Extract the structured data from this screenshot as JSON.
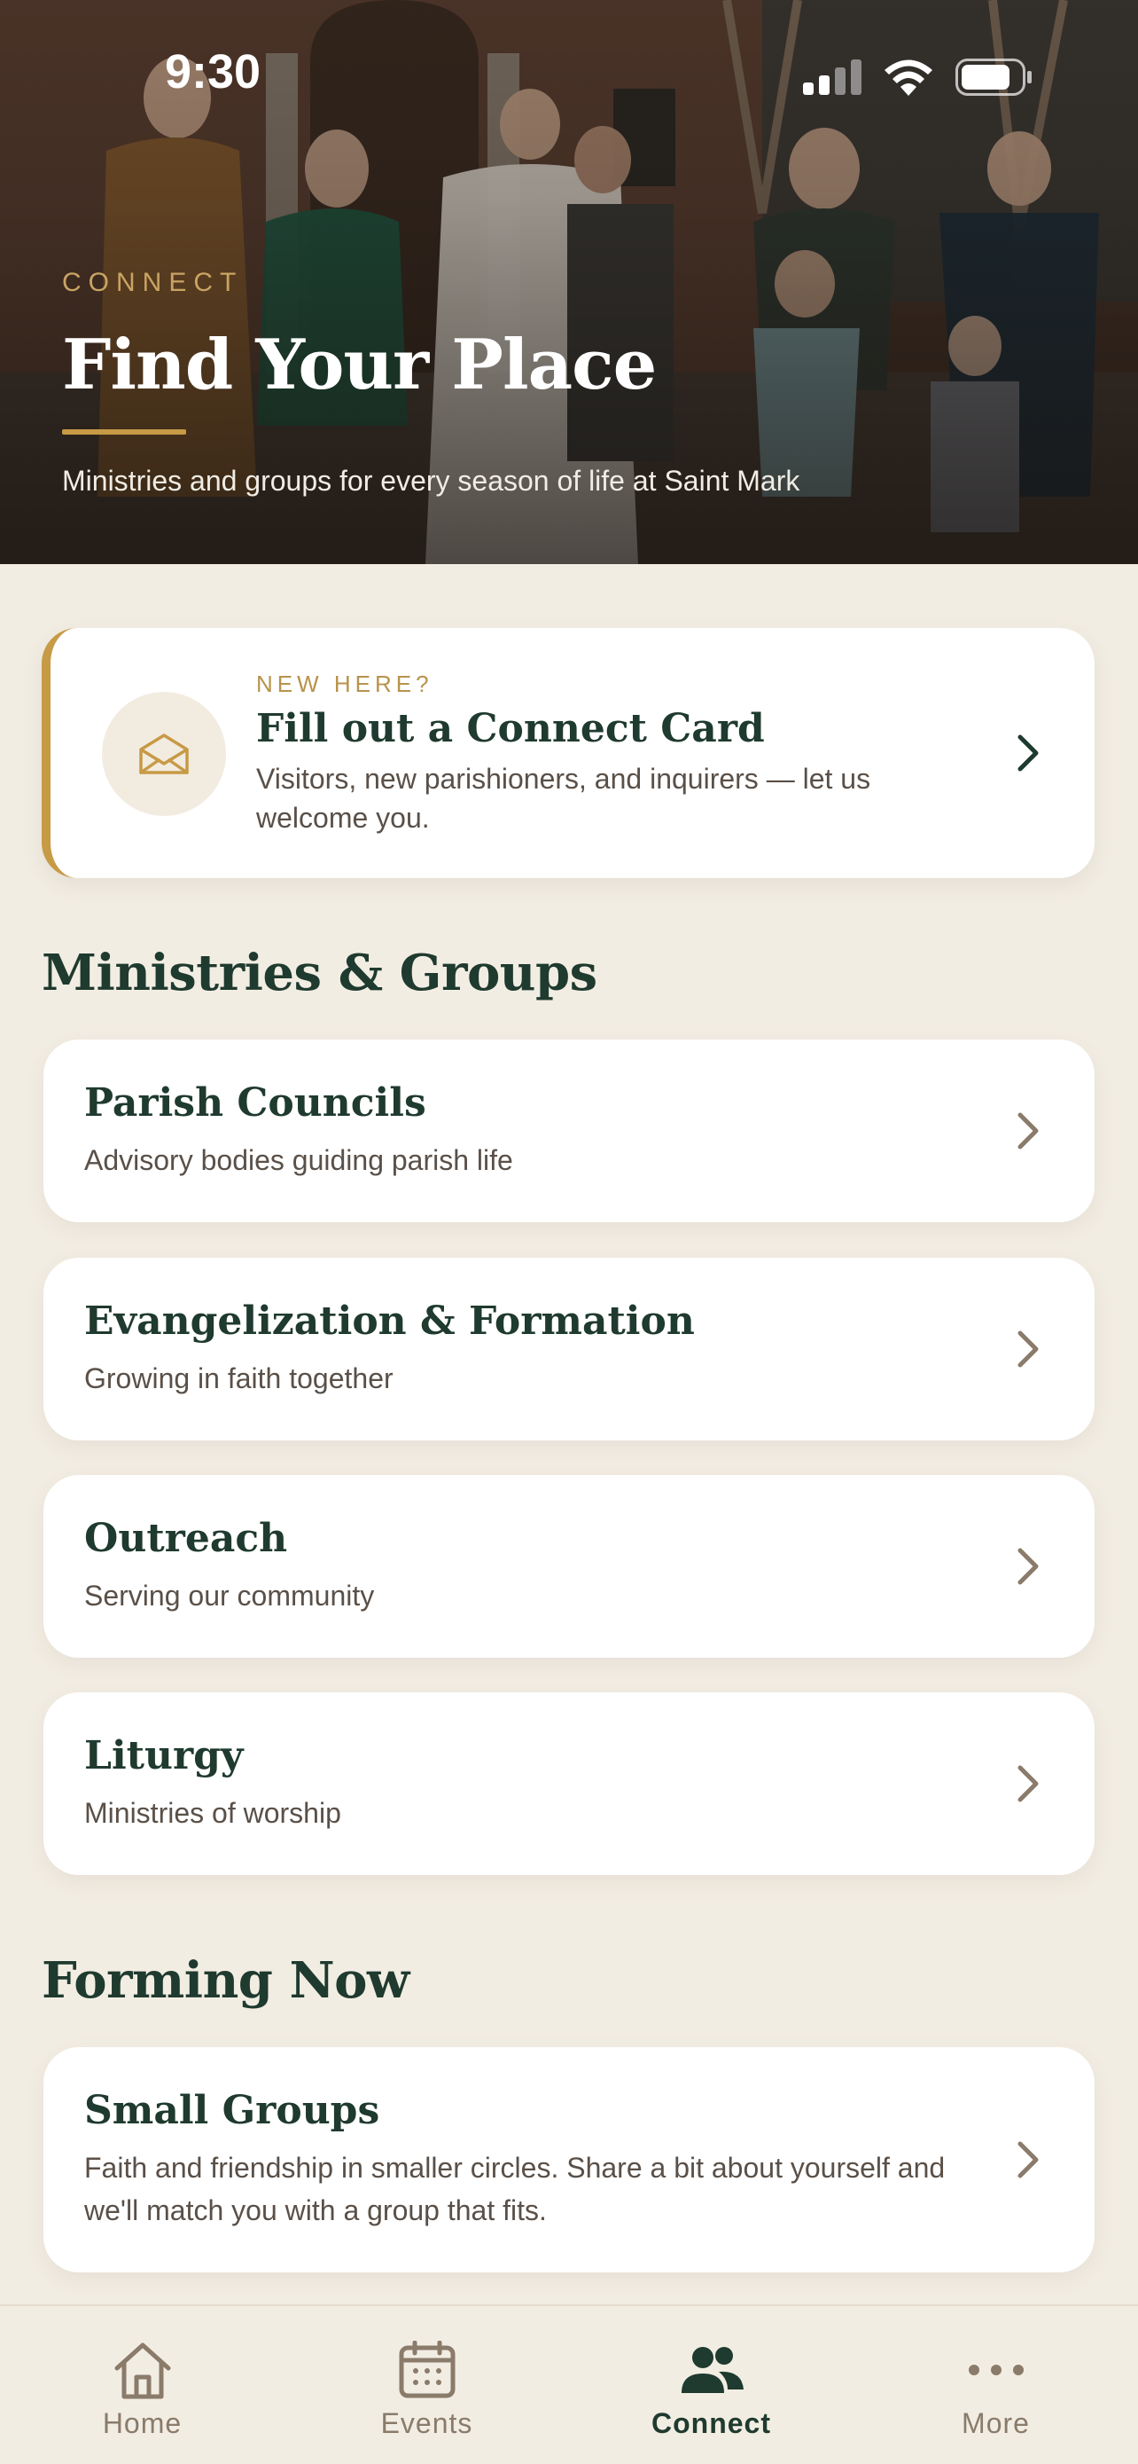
{
  "status": {
    "time": "9:30"
  },
  "hero": {
    "eyebrow": "CONNECT",
    "title": "Find Your Place",
    "subtitle": "Ministries and groups for every season of life at Saint Mark"
  },
  "connect_card": {
    "eyebrow": "NEW HERE?",
    "title": "Fill out a Connect Card",
    "description": "Visitors, new parishioners, and inquirers — let us welcome you.",
    "icon": "envelope-icon"
  },
  "ministries": {
    "heading": "Ministries & Groups",
    "items": [
      {
        "title": "Parish Councils",
        "subtitle": "Advisory bodies guiding parish life"
      },
      {
        "title": "Evangelization & Formation",
        "subtitle": "Growing in faith together"
      },
      {
        "title": "Outreach",
        "subtitle": "Serving our community"
      },
      {
        "title": "Liturgy",
        "subtitle": "Ministries of worship"
      }
    ]
  },
  "forming_now": {
    "heading": "Forming Now",
    "items": [
      {
        "title": "Small Groups",
        "subtitle": "Faith and friendship in smaller circles. Share a bit about yourself and we'll match you with a group that fits."
      }
    ]
  },
  "tabs": [
    {
      "label": "Home",
      "icon": "home-icon",
      "active": false
    },
    {
      "label": "Events",
      "icon": "calendar-icon",
      "active": false
    },
    {
      "label": "Connect",
      "icon": "people-icon",
      "active": true
    },
    {
      "label": "More",
      "icon": "more-icon",
      "active": false
    }
  ],
  "colors": {
    "background": "#f2ede3",
    "primary": "#1f3a2e",
    "accent": "#c79a45",
    "muted_text": "#5a5048",
    "tab_inactive": "#8a7b6a"
  }
}
